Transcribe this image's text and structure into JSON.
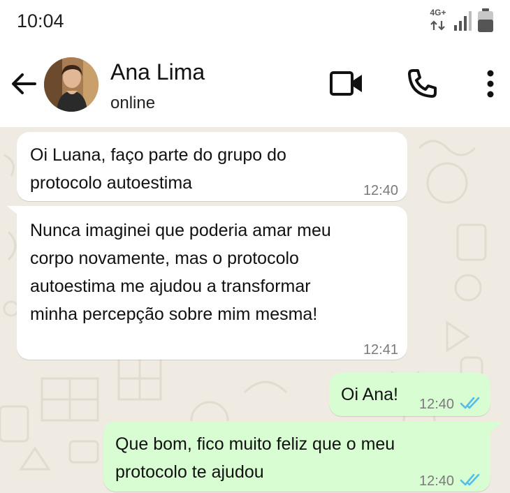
{
  "status_bar": {
    "time": "10:04",
    "network": "4G+",
    "icons": [
      "network-arrows-icon",
      "signal-icon",
      "battery-icon"
    ]
  },
  "header": {
    "contact_name": "Ana Lima",
    "contact_status": "online",
    "icons": [
      "back-arrow-icon",
      "video-call-icon",
      "phone-icon",
      "more-options-icon"
    ]
  },
  "messages": [
    {
      "direction": "incoming",
      "text": "Oi Luana, faço parte do grupo do\nprotocolo autoestima",
      "time": "12:40"
    },
    {
      "direction": "incoming",
      "text": "Nunca imaginei que poderia amar meu\ncorpo novamente, mas o protocolo\nautoestima me ajudou a transformar\nminha percepção sobre mim mesma!",
      "time": "12:41"
    },
    {
      "direction": "outgoing",
      "text": "Oi Ana!",
      "time": "12:40",
      "status": "read"
    },
    {
      "direction": "outgoing",
      "text": "Que bom, fico muito feliz que o meu\nprotocolo te ajudou",
      "time": "12:40",
      "status": "read"
    }
  ],
  "colors": {
    "chat_background": "#efeae2",
    "incoming_bubble": "#ffffff",
    "outgoing_bubble": "#d9fdd3",
    "read_ticks": "#53bdeb"
  }
}
